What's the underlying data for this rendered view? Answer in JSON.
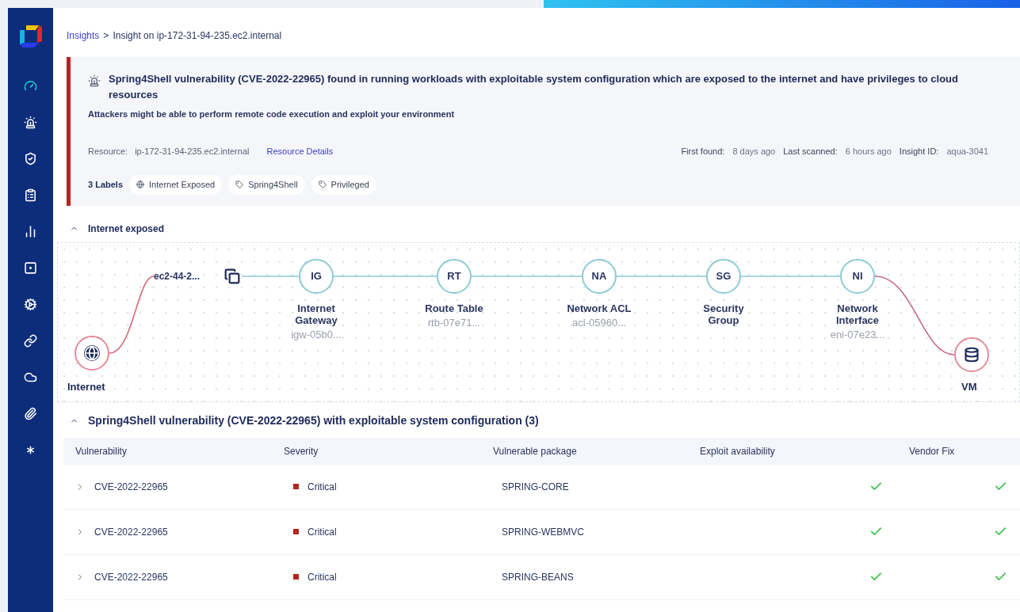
{
  "sidebar": {
    "items": [
      {
        "kind": "gauge",
        "selected": true
      },
      {
        "kind": "siren",
        "selected": false
      },
      {
        "kind": "shield",
        "selected": false
      },
      {
        "kind": "clipboard",
        "selected": false
      },
      {
        "kind": "chart",
        "selected": false
      },
      {
        "kind": "square",
        "selected": false
      },
      {
        "kind": "gear",
        "selected": false
      },
      {
        "kind": "link",
        "selected": false
      },
      {
        "kind": "cloud",
        "selected": false
      },
      {
        "kind": "paperclip",
        "selected": false
      },
      {
        "kind": "asterisk",
        "selected": false
      }
    ]
  },
  "breadcrumb": {
    "parent": "Insights",
    "separator": ">",
    "current": "Insight on ip-172-31-94-235.ec2.internal"
  },
  "insight": {
    "title": "Spring4Shell vulnerability (CVE-2022-22965) found in running workloads with exploitable system configuration which are exposed to the internet and have privileges to cloud resources",
    "description": "Attackers might be able to perform remote code execution and exploit your environment",
    "resource_label": "Resource:",
    "resource_value": "ip-172-31-94-235.ec2.internal",
    "resource_link": "Resource Details",
    "meta": [
      {
        "label": "First found:",
        "value": "8 days ago"
      },
      {
        "label": "Last scanned:",
        "value": "6 hours ago"
      },
      {
        "label": "Insight ID:",
        "value": "aqua-3041"
      }
    ],
    "labels_count": "3 Labels",
    "labels": [
      {
        "kind": "globe",
        "text": "Internet Exposed"
      },
      {
        "kind": "tag",
        "text": "Spring4Shell"
      },
      {
        "kind": "tag",
        "text": "Privileged"
      }
    ]
  },
  "graph": {
    "title": "Internet exposed",
    "expanded": true,
    "edge_label": "ec2-44-2...",
    "nodes": [
      {
        "kind": "source",
        "name": "Internet"
      },
      {
        "kind": "hop",
        "abbr": "IG",
        "name": "Internet Gateway",
        "id": "igw-05b0..."
      },
      {
        "kind": "hop",
        "abbr": "RT",
        "name": "Route Table",
        "id": "rtb-07e71..."
      },
      {
        "kind": "hop",
        "abbr": "NA",
        "name": "Network ACL",
        "id": "acl-05960..."
      },
      {
        "kind": "hop",
        "abbr": "SG",
        "name": "Security Group"
      },
      {
        "kind": "hop",
        "abbr": "NI",
        "name": "Network Interface",
        "id": "eni-07e23..."
      },
      {
        "kind": "target",
        "name": "VM"
      }
    ]
  },
  "vulnerabilities": {
    "title": "Spring4Shell vulnerability (CVE-2022-22965) with exploitable system configuration (3)",
    "expanded": true,
    "columns": [
      "Vulnerability",
      "Severity",
      "Vulnerable package",
      "Exploit availability",
      "Vendor Fix"
    ],
    "rows": [
      {
        "expanded": false,
        "cve": "CVE-2022-22965",
        "severity": "Critical",
        "color": "#b3261e",
        "package": "SPRING-CORE",
        "exploit": true,
        "vendor_fix": true
      },
      {
        "expanded": false,
        "cve": "CVE-2022-22965",
        "severity": "Critical",
        "color": "#b3261e",
        "package": "SPRING-WEBMVC",
        "exploit": true,
        "vendor_fix": true
      },
      {
        "expanded": false,
        "cve": "CVE-2022-22965",
        "severity": "Critical",
        "color": "#b3261e",
        "package": "SPRING-BEANS",
        "exploit": true,
        "vendor_fix": true
      }
    ]
  }
}
